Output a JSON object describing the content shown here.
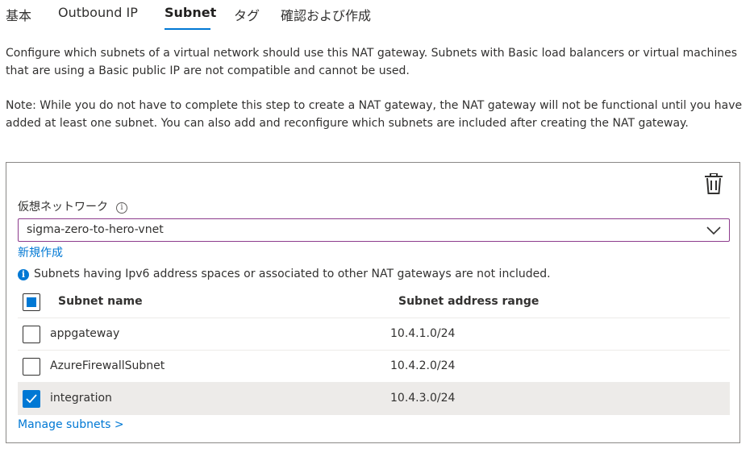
{
  "tabs": [
    {
      "label": "基本"
    },
    {
      "label": "Outbound IP"
    },
    {
      "label": "Subnet",
      "active": true
    },
    {
      "label": "タグ"
    },
    {
      "label": "確認および作成"
    }
  ],
  "description": "Configure which subnets of a virtual network should use this NAT gateway. Subnets with Basic load balancers or virtual machines that are using a Basic public IP are not compatible and cannot be used.",
  "note": "Note: While you do not have to complete this step to create a NAT gateway, the NAT gateway will not be functional until you have added at least one subnet. You can also add and reconfigure which subnets are included after creating the NAT gateway.",
  "vnet": {
    "label": "仮想ネットワーク",
    "selected": "sigma-zero-to-hero-vnet",
    "create_new": "新規作成"
  },
  "notice": "Subnets having Ipv6 address spaces or associated to other NAT gateways are not included.",
  "table": {
    "columns": [
      "Subnet name",
      "Subnet address range"
    ],
    "header_checkbox": "indeterminate",
    "rows": [
      {
        "name": "appgateway",
        "range": "10.4.1.0/24",
        "checked": false
      },
      {
        "name": "AzureFirewallSubnet",
        "range": "10.4.2.0/24",
        "checked": false
      },
      {
        "name": "integration",
        "range": "10.4.3.0/24",
        "checked": true
      }
    ]
  },
  "manage_link": "Manage subnets >",
  "icons": {
    "delete": "trash-icon",
    "dropdown": "chevron-down-icon",
    "info": "info-icon"
  },
  "colors": {
    "accent": "#0078d4",
    "select_border": "#8c3b8c",
    "selected_row": "#edebe9"
  }
}
